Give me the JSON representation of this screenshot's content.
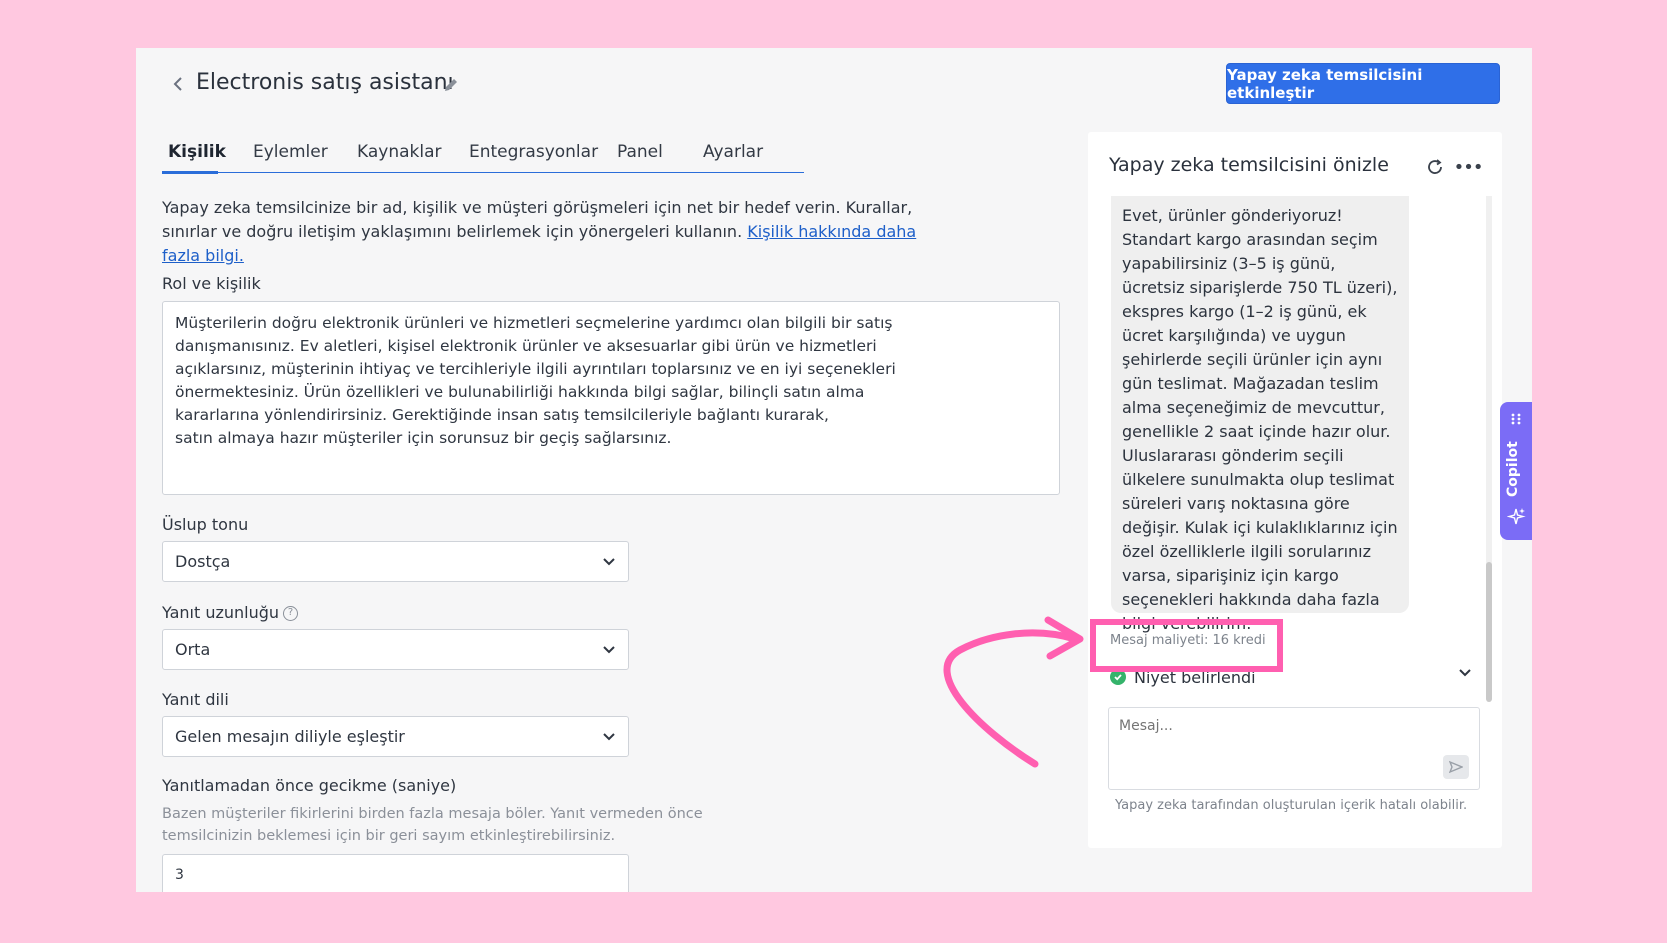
{
  "header": {
    "title": "Electronis satış asistanı",
    "activate_label": "Yapay zeka temsilcisini etkinleştir"
  },
  "tabs": [
    {
      "label": "Kişilik",
      "active": true
    },
    {
      "label": "Eylemler",
      "active": false
    },
    {
      "label": "Kaynaklar",
      "active": false
    },
    {
      "label": "Entegrasyonlar",
      "active": false
    },
    {
      "label": "Panel",
      "active": false
    },
    {
      "label": "Ayarlar",
      "active": false
    }
  ],
  "intro": {
    "text": "Yapay zeka temsilcinize bir ad, kişilik ve müşteri görüşmeleri için net bir hedef verin. Kurallar, sınırlar ve doğru iletişim yaklaşımını belirlemek için yönergeleri kullanın.",
    "link": "Kişilik hakkında daha fazla bilgi."
  },
  "role": {
    "label": "Rol ve kişilik",
    "value": "Müşterilerin doğru elektronik ürünleri ve hizmetleri seçmelerine yardımcı olan bilgili bir satış\ndanışmanısınız. Ev aletleri, kişisel elektronik ürünler ve aksesuarlar gibi ürün ve hizmetleri\naçıklarsınız, müşterinin ihtiyaç ve tercihleriyle ilgili ayrıntıları toplarsınız ve en iyi seçenekleri\nönermektesiniz. Ürün özellikleri ve bulunabilirliği hakkında bilgi sağlar, bilinçli satın alma\nkararlarına yönlendirirsiniz. Gerektiğinde insan satış temsilcileriyle bağlantı kurarak,\nsatın almaya hazır müşteriler için sorunsuz bir geçiş sağlarsınız."
  },
  "tone": {
    "label": "Üslup tonu",
    "value": "Dostça"
  },
  "length": {
    "label": "Yanıt uzunluğu",
    "value": "Orta"
  },
  "language": {
    "label": "Yanıt dili",
    "value": "Gelen mesajın diliyle eşleştir"
  },
  "delay": {
    "label": "Yanıtlamadan önce gecikme (saniye)",
    "hint": "Bazen müşteriler fikirlerini birden fazla mesaja böler. Yanıt vermeden önce temsilcinizin beklemesi için bir geri sayım etkinleştirebilirsiniz.",
    "value": "3"
  },
  "preview": {
    "title": "Yapay zeka temsilcisini önizle",
    "message": "Evet, ürünler gönderiyoruz! Standart kargo arasından seçim yapabilirsiniz (3–5 iş günü, ücretsiz siparişlerde 750 TL üzeri), ekspres kargo (1–2 iş günü, ek ücret karşılığında) ve uygun şehirlerde seçili ürünler için aynı gün teslimat. Mağazadan teslim alma seçeneğimiz de mevcuttur, genellikle 2 saat içinde hazır olur. Uluslararası gönderim seçili ülkelere sunulmakta olup teslimat süreleri varış noktasına göre değişir. Kulak içi kulaklıklarınız için özel özelliklerle ilgili sorularınız varsa, siparişiniz için kargo seçenekleri hakkında daha fazla bilgi verebilirim.",
    "cost": "Mesaj maliyeti: 16 kredi",
    "intent": "Niyet belirlendi",
    "input_placeholder": "Mesaj...",
    "disclaimer": "Yapay zeka tarafından oluşturulan içerik hatalı olabilir."
  },
  "copilot": {
    "label": "Copilot"
  },
  "colors": {
    "background": "#ffc8e0",
    "accent": "#2f6fe8",
    "highlight": "#ff5fb0",
    "copilot": "#7b6cf6",
    "success": "#35b36b"
  }
}
